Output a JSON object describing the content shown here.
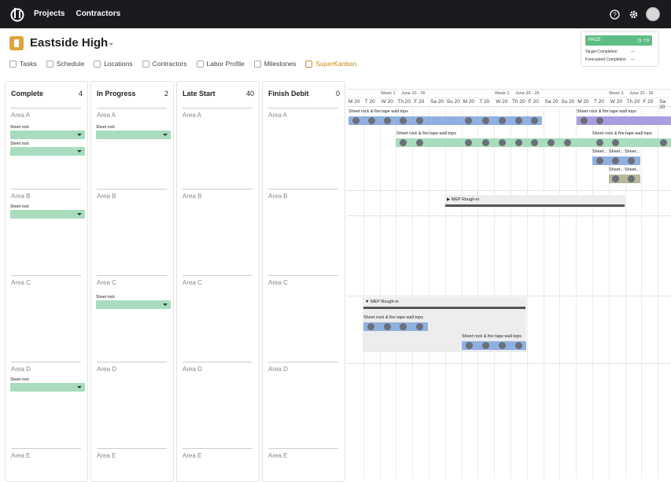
{
  "nav": {
    "projects": "Projects",
    "contractors": "Contractors"
  },
  "project": {
    "title": "Eastside High"
  },
  "subnav": [
    "Tasks",
    "Schedule",
    "Locations",
    "Contractors",
    "Labor Profile",
    "Milestones",
    "SuperKanban"
  ],
  "pace": {
    "label": "PACE",
    "value": "+3",
    "target_label": "Target Completion",
    "target_value": "—",
    "forecast_label": "Forecasted Completion",
    "forecast_value": "—"
  },
  "columns": [
    {
      "title": "Complete",
      "count": "4"
    },
    {
      "title": "In Progress",
      "count": "2"
    },
    {
      "title": "Late Start",
      "count": "40"
    },
    {
      "title": "Finish Debit",
      "count": "0"
    }
  ],
  "areas": [
    "Area A",
    "Area B",
    "Area C",
    "Area D",
    "Area E"
  ],
  "card_label": "Sheet rock",
  "gantt": {
    "weeks": [
      "Week 1",
      "June 20 - 26",
      "Week 2",
      "June 20 - 26",
      "Week 3",
      "June 20 - 26"
    ],
    "days": [
      "M 20",
      "T 20",
      "W 20",
      "Th 20",
      "F 20",
      "Sa 20",
      "Su 20",
      "M 20",
      "T 20",
      "W 20",
      "Th 20",
      "F 20",
      "Sa 20",
      "Su 20",
      "M 20",
      "T 20",
      "W 20",
      "Th 20",
      "F 20",
      "Sa 20"
    ],
    "task_full": "Sheet rock & fire tape wall tops",
    "task_short": "Sheet...",
    "group_label": "MEP Rough-in"
  }
}
